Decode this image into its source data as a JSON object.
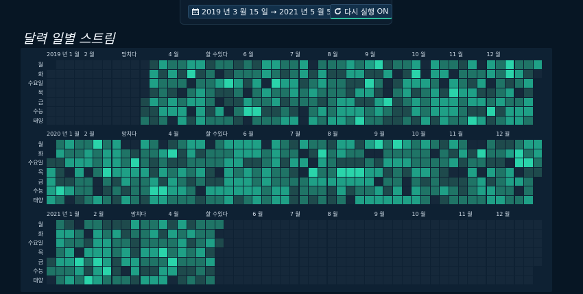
{
  "toolbar": {
    "date_range_label": "2019 년 3 월 15 일 ➞ 2021 년 5 월 5 일",
    "rerun_label": "다시 실행",
    "rerun_state": "ON",
    "calendar_icon": "calendar-icon",
    "refresh_icon": "refresh-icon"
  },
  "title": "달력 일별 스트림",
  "day_labels": [
    "월",
    "화",
    "수요일",
    "목",
    "금",
    "수능",
    "태양"
  ],
  "colors": {
    "empty": "#15283a",
    "low": "#1e4a4c",
    "mid": "#1f7466",
    "high": "#1fa086",
    "peak": "#2ad4aa",
    "accent": "#2fbf9f"
  },
  "years": [
    {
      "year_label": "2019 년 1 월",
      "month_labels": [
        {
          "label": "2 월",
          "week": 4
        },
        {
          "label": "망치다",
          "week": 8
        },
        {
          "label": "4 월",
          "week": 13
        },
        {
          "label": "할 수있다",
          "week": 17
        },
        {
          "label": "6 월",
          "week": 21
        },
        {
          "label": "7 월",
          "week": 26
        },
        {
          "label": "8 월",
          "week": 30
        },
        {
          "label": "9 월",
          "week": 34
        },
        {
          "label": "10 월",
          "week": 39
        },
        {
          "label": "11 월",
          "week": 43
        },
        {
          "label": "12 월",
          "week": 47
        }
      ],
      "start": "2019-03-15",
      "end": "2019-12-31",
      "seed": 11
    },
    {
      "year_label": "2020 년 1 월",
      "month_labels": [
        {
          "label": "2 월",
          "week": 4
        },
        {
          "label": "망치다",
          "week": 8
        },
        {
          "label": "4 월",
          "week": 13
        },
        {
          "label": "할 수있다",
          "week": 17
        },
        {
          "label": "6 월",
          "week": 21
        },
        {
          "label": "7 월",
          "week": 26
        },
        {
          "label": "8 월",
          "week": 30
        },
        {
          "label": "9 월",
          "week": 35
        },
        {
          "label": "10 월",
          "week": 39
        },
        {
          "label": "11 월",
          "week": 43
        },
        {
          "label": "12 월",
          "week": 48
        }
      ],
      "start": "2020-01-01",
      "end": "2020-12-31",
      "seed": 29
    },
    {
      "year_label": "2021 년 1 월",
      "month_labels": [
        {
          "label": "2 월",
          "week": 5
        },
        {
          "label": "망치다",
          "week": 9
        },
        {
          "label": "4 월",
          "week": 13
        },
        {
          "label": "할 수있다",
          "week": 17
        },
        {
          "label": "6 월",
          "week": 22
        },
        {
          "label": "7 월",
          "week": 26
        },
        {
          "label": "8 월",
          "week": 30
        },
        {
          "label": "9 월",
          "week": 35
        },
        {
          "label": "10 월",
          "week": 39
        },
        {
          "label": "11 월",
          "week": 44
        },
        {
          "label": "12 월",
          "week": 48
        }
      ],
      "start": "2021-01-01",
      "end": "2021-05-05",
      "seed": 47
    }
  ]
}
